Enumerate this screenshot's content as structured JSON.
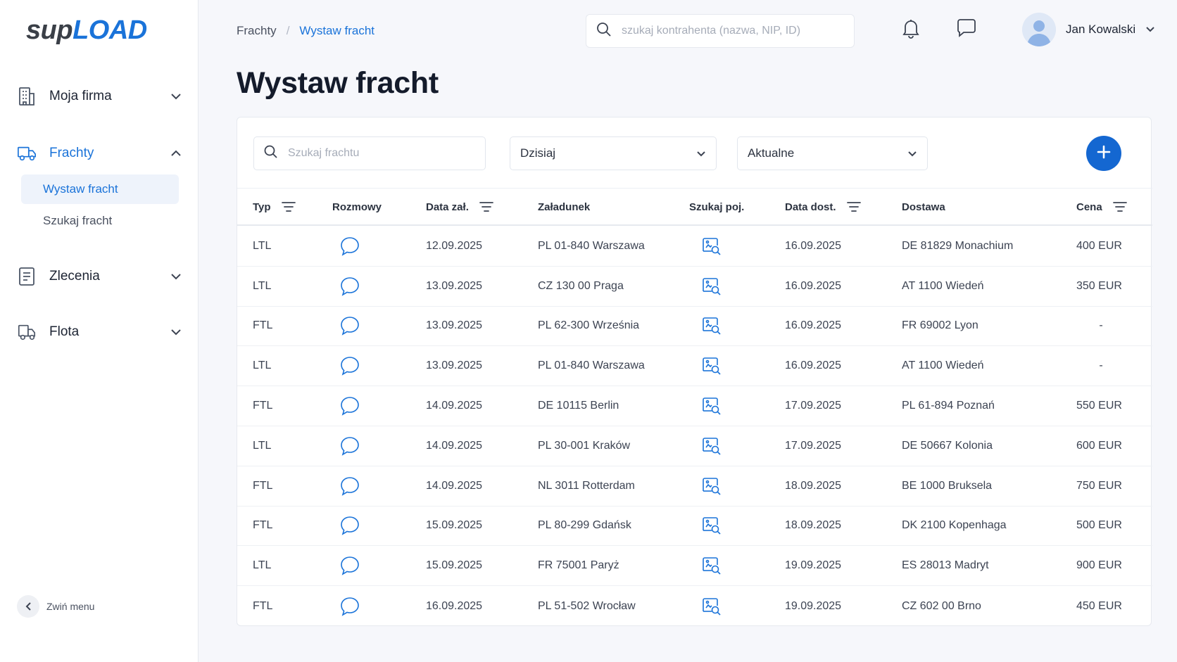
{
  "logo": {
    "part1": "sup",
    "part2": "LOAD"
  },
  "sidebar": {
    "items": [
      {
        "label": "Moja firma"
      },
      {
        "label": "Frachty"
      },
      {
        "label": "Zlecenia"
      },
      {
        "label": "Flota"
      }
    ],
    "sub_items": [
      {
        "label": "Wystaw fracht"
      },
      {
        "label": "Szukaj fracht"
      }
    ],
    "collapse_label": "Zwiń menu"
  },
  "header": {
    "breadcrumb": {
      "parent": "Frachty",
      "separator": "/",
      "current": "Wystaw fracht"
    },
    "search_placeholder": "szukaj kontrahenta (nazwa, NIP, ID)",
    "user_name": "Jan Kowalski"
  },
  "page": {
    "title": "Wystaw fracht"
  },
  "filters": {
    "search_placeholder": "Szukaj frachtu",
    "date_value": "Dzisiaj",
    "status_value": "Aktualne"
  },
  "table": {
    "columns": {
      "typ": "Typ",
      "rozmowy": "Rozmowy",
      "data_zal": "Data zał.",
      "zaladunek": "Załadunek",
      "szukaj_poj": "Szukaj poj.",
      "data_dost": "Data dost.",
      "dostawa": "Dostawa",
      "cena": "Cena"
    },
    "rows": [
      {
        "typ": "LTL",
        "data_zal": "12.09.2025",
        "zaladunek": "PL 01-840 Warszawa",
        "data_dost": "16.09.2025",
        "dostawa": "DE 81829 Monachium",
        "cena": "400 EUR"
      },
      {
        "typ": "LTL",
        "data_zal": "13.09.2025",
        "zaladunek": "CZ 130 00 Praga",
        "data_dost": "16.09.2025",
        "dostawa": "AT 1100 Wiedeń",
        "cena": "350 EUR"
      },
      {
        "typ": "FTL",
        "data_zal": "13.09.2025",
        "zaladunek": "PL 62-300 Września",
        "data_dost": "16.09.2025",
        "dostawa": "FR 69002 Lyon",
        "cena": "-"
      },
      {
        "typ": "LTL",
        "data_zal": "13.09.2025",
        "zaladunek": "PL 01-840 Warszawa",
        "data_dost": "16.09.2025",
        "dostawa": "AT 1100 Wiedeń",
        "cena": "-"
      },
      {
        "typ": "FTL",
        "data_zal": "14.09.2025",
        "zaladunek": "DE 10115 Berlin",
        "data_dost": "17.09.2025",
        "dostawa": "PL 61-894 Poznań",
        "cena": "550 EUR"
      },
      {
        "typ": "LTL",
        "data_zal": "14.09.2025",
        "zaladunek": "PL 30-001 Kraków",
        "data_dost": "17.09.2025",
        "dostawa": "DE 50667 Kolonia",
        "cena": "600 EUR"
      },
      {
        "typ": "FTL",
        "data_zal": "14.09.2025",
        "zaladunek": "NL 3011 Rotterdam",
        "data_dost": "18.09.2025",
        "dostawa": "BE 1000 Bruksela",
        "cena": "750 EUR"
      },
      {
        "typ": "FTL",
        "data_zal": "15.09.2025",
        "zaladunek": "PL 80-299 Gdańsk",
        "data_dost": "18.09.2025",
        "dostawa": "DK 2100 Kopenhaga",
        "cena": "500 EUR"
      },
      {
        "typ": "LTL",
        "data_zal": "15.09.2025",
        "zaladunek": "FR 75001 Paryż",
        "data_dost": "19.09.2025",
        "dostawa": "ES 28013 Madryt",
        "cena": "900 EUR"
      },
      {
        "typ": "FTL",
        "data_zal": "16.09.2025",
        "zaladunek": "PL 51-502 Wrocław",
        "data_dost": "19.09.2025",
        "dostawa": "CZ 602 00 Brno",
        "cena": "450 EUR"
      }
    ]
  },
  "colors": {
    "accent": "#1a73d9",
    "button": "#1467d1",
    "text": "#1d2433",
    "background": "#f6f7fb"
  },
  "icons": {
    "nav": [
      "building-icon",
      "truck-icon",
      "document-icon",
      "fleet-truck-icon"
    ],
    "header": [
      "search-icon",
      "bell-icon",
      "chat-icon",
      "avatar-icon",
      "chevron-down-icon"
    ],
    "table": [
      "filter-icon",
      "chat-bubble-icon",
      "search-vehicle-icon"
    ],
    "actions": [
      "plus-icon",
      "chevron-left-icon"
    ]
  }
}
